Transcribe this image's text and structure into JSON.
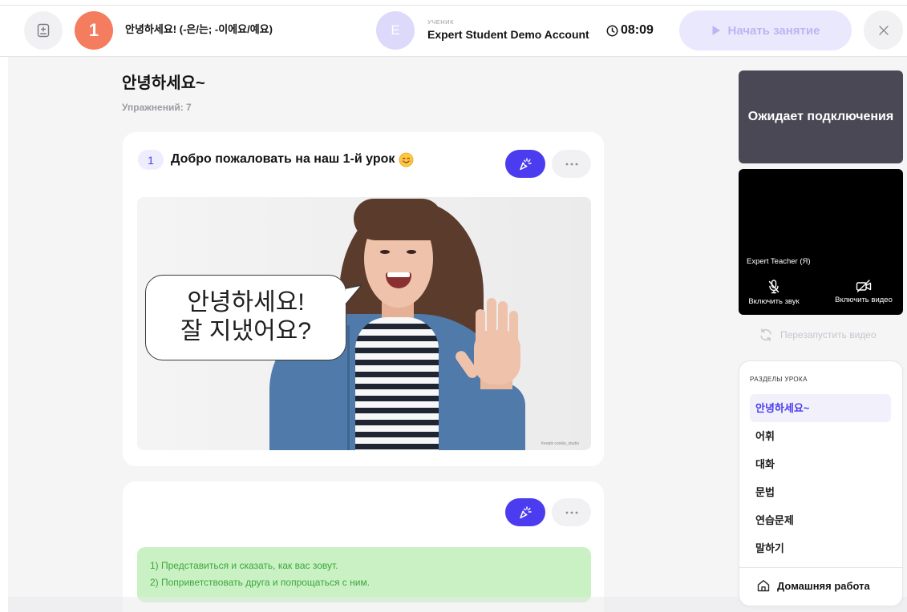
{
  "header": {
    "lesson_number": "1",
    "lesson_title": "안녕하세요! (-은/는; -이에요/예요)",
    "student_initial": "E",
    "student_role": "УЧЕНИК",
    "student_name": "Expert Student Demo Account",
    "timer": "08:09",
    "start_button": "Начать занятие"
  },
  "main": {
    "section_title": "안녕하세요~",
    "exercise_count": "Упражнений: 7",
    "exercises": [
      {
        "number": "1",
        "title": "Добро пожаловать на наш 1-й урок",
        "title_emoji_icon": "smiling-face-icon",
        "image": {
          "bubble_line1": "안녕하세요!",
          "bubble_line2": "잘 지냈어요?",
          "credit": "freepik cookie_studio"
        }
      },
      {
        "tasks": [
          "1) Представиться и сказать, как вас зовут.",
          "2) Поприветствовать друга и попрощаться с ним."
        ]
      }
    ]
  },
  "video": {
    "waiting_text": "Ожидает подключения",
    "self_name": "Expert Teacher (Я)",
    "mic_label": "Включить звук",
    "camera_label": "Включить видео",
    "restart_label": "Перезапустить видео"
  },
  "sections": {
    "heading": "РАЗДЕЛЫ УРОКА",
    "items": [
      "안녕하세요~",
      "어휘",
      "대화",
      "문법",
      "연습문제",
      "말하기"
    ],
    "active_index": 0,
    "homework": "Домашняя работа"
  },
  "icons": {
    "notes_button": "notebook-plus-icon",
    "timer": "clock-icon",
    "start_button": "play-icon",
    "close_button": "close-icon",
    "exercise_action": "click-sparkle-icon",
    "exercise_more": "more-icon",
    "microphone": "mic-off-icon",
    "camera": "camera-off-icon",
    "restart_video": "refresh-icon",
    "homework": "home-icon"
  },
  "colors": {
    "accent": "#4B3CF0",
    "lesson_badge": "#F47C5F",
    "avatar": "#DCD9FB",
    "start_bg": "#E9E8FD",
    "start_text": "#BAB6F2",
    "waiting_bg": "#4A4855",
    "task_bg": "#C9F1C4",
    "task_text": "#3DA63D",
    "active_section_bg": "#F1F0FB",
    "page_bg": "#F5F5F6"
  }
}
